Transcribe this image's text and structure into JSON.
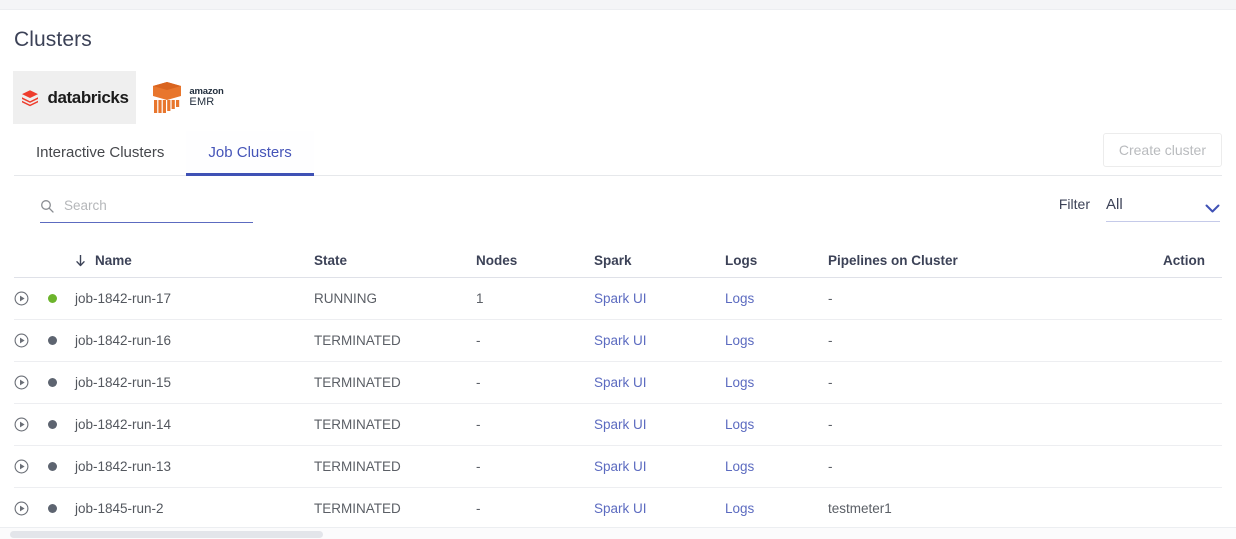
{
  "page": {
    "title": "Clusters"
  },
  "providers": [
    {
      "name": "databricks",
      "label": "databricks",
      "selected": true,
      "icon": "databricks-logo-icon"
    },
    {
      "name": "amazon-emr",
      "label_top": "amazon",
      "label_bottom": "EMR",
      "selected": false,
      "icon": "amazon-emr-logo-icon"
    }
  ],
  "tabs": [
    {
      "label": "Interactive Clusters",
      "active": false
    },
    {
      "label": "Job Clusters",
      "active": true
    }
  ],
  "actions": {
    "create_cluster": "Create cluster",
    "create_cluster_disabled": true
  },
  "search": {
    "placeholder": "Search",
    "value": "",
    "icon": "search-icon"
  },
  "filter": {
    "label": "Filter",
    "value": "All",
    "options": [
      "All"
    ],
    "icon": "chevron-down-icon"
  },
  "table": {
    "sort": {
      "column": "Name",
      "direction": "desc",
      "icon": "arrow-down-icon"
    },
    "columns": [
      "Name",
      "State",
      "Nodes",
      "Spark",
      "Logs",
      "Pipelines on Cluster",
      "Action"
    ],
    "rows": [
      {
        "name": "job-1842-run-17",
        "state": "RUNNING",
        "status": "running",
        "nodes": "1",
        "spark": "Spark UI",
        "logs": "Logs",
        "pipelines": "-",
        "action": ""
      },
      {
        "name": "job-1842-run-16",
        "state": "TERMINATED",
        "status": "terminated",
        "nodes": "-",
        "spark": "Spark UI",
        "logs": "Logs",
        "pipelines": "-",
        "action": ""
      },
      {
        "name": "job-1842-run-15",
        "state": "TERMINATED",
        "status": "terminated",
        "nodes": "-",
        "spark": "Spark UI",
        "logs": "Logs",
        "pipelines": "-",
        "action": ""
      },
      {
        "name": "job-1842-run-14",
        "state": "TERMINATED",
        "status": "terminated",
        "nodes": "-",
        "spark": "Spark UI",
        "logs": "Logs",
        "pipelines": "-",
        "action": ""
      },
      {
        "name": "job-1842-run-13",
        "state": "TERMINATED",
        "status": "terminated",
        "nodes": "-",
        "spark": "Spark UI",
        "logs": "Logs",
        "pipelines": "-",
        "action": ""
      },
      {
        "name": "job-1845-run-2",
        "state": "TERMINATED",
        "status": "terminated",
        "nodes": "-",
        "spark": "Spark UI",
        "logs": "Logs",
        "pipelines": "testmeter1",
        "action": ""
      }
    ]
  },
  "colors": {
    "accent": "#3f51b5",
    "link": "#5c6bc0",
    "running": "#6cb42c",
    "terminated": "#5d6470",
    "text": "#3c4257",
    "databricks_red": "#ee3d2d",
    "emr_orange": "#e8762d"
  }
}
